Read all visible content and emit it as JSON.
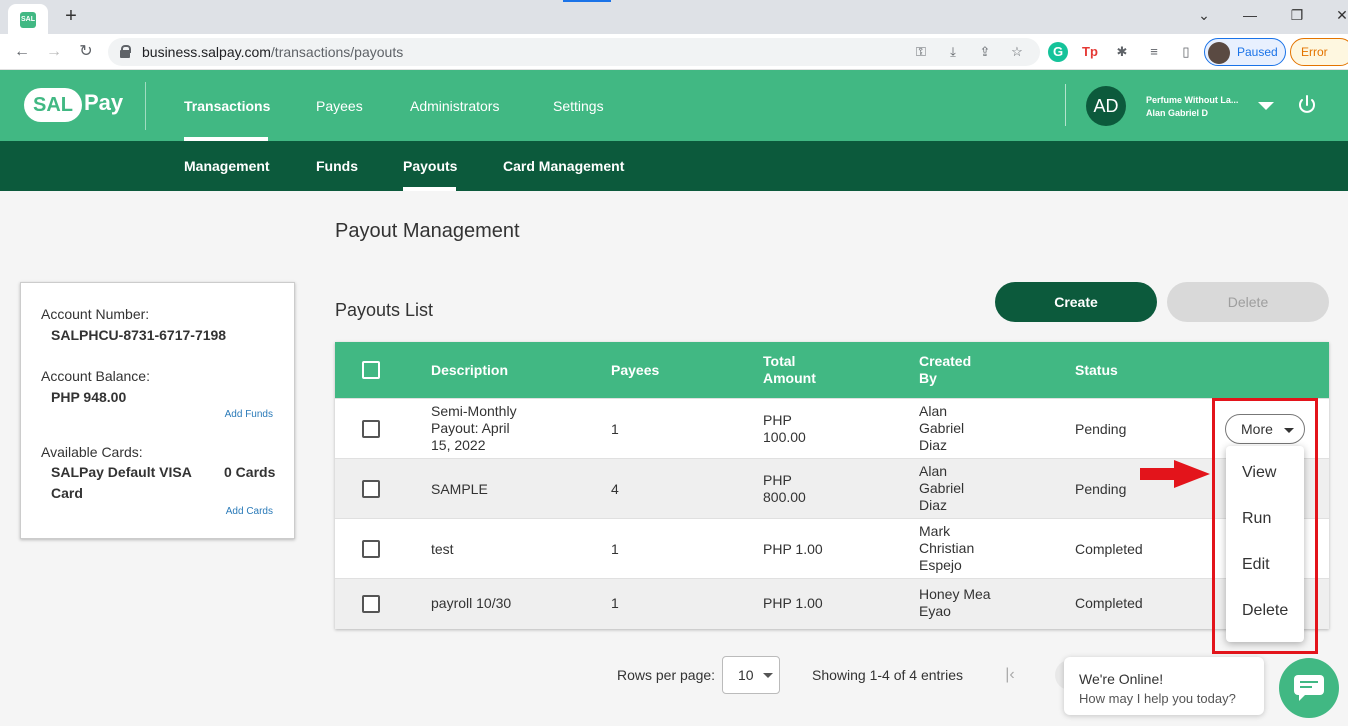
{
  "browser": {
    "url_domain": "business.salpay.com",
    "url_path": "/transactions/payouts",
    "profile_status": "Paused",
    "error_label": "Error"
  },
  "header": {
    "logo_sal": "SAL",
    "logo_pay": "Pay",
    "nav": [
      "Transactions",
      "Payees",
      "Administrators",
      "Settings"
    ],
    "active_nav": "Transactions",
    "avatar_initials": "AD",
    "business_name": "Perfume Without La...",
    "user_name": "Alan Gabriel D"
  },
  "subnav": {
    "items": [
      "Management",
      "Funds",
      "Payouts",
      "Card Management"
    ],
    "active": "Payouts"
  },
  "page": {
    "title": "Payout Management",
    "list_title": "Payouts List",
    "create_label": "Create",
    "delete_label": "Delete"
  },
  "account": {
    "number_label": "Account Number:",
    "number": "SALPHCU-8731-6717-7198",
    "balance_label": "Account Balance:",
    "balance": "PHP 948.00",
    "add_funds": "Add Funds",
    "cards_label": "Available Cards:",
    "card_name_line1": "SALPay Default VISA",
    "card_name_line2": "Card",
    "cards_count": "0 Cards",
    "add_cards": "Add Cards"
  },
  "table": {
    "headers": {
      "description": "Description",
      "payees": "Payees",
      "total_amount_1": "Total",
      "total_amount_2": "Amount",
      "created_by_1": "Created",
      "created_by_2": "By",
      "status": "Status"
    },
    "rows": [
      {
        "desc": [
          "Semi-Monthly",
          "Payout: April",
          "15, 2022"
        ],
        "payees": "1",
        "amount": [
          "PHP",
          "100.00"
        ],
        "created": [
          "Alan",
          "Gabriel",
          "Diaz"
        ],
        "status": "Pending"
      },
      {
        "desc": [
          "SAMPLE"
        ],
        "payees": "4",
        "amount": [
          "PHP",
          "800.00"
        ],
        "created": [
          "Alan",
          "Gabriel",
          "Diaz"
        ],
        "status": "Pending"
      },
      {
        "desc": [
          "test"
        ],
        "payees": "1",
        "amount": [
          "PHP 1.00"
        ],
        "created": [
          "Mark",
          "Christian",
          "Espejo"
        ],
        "status": "Completed"
      },
      {
        "desc": [
          "payroll 10/30"
        ],
        "payees": "1",
        "amount": [
          "PHP 1.00"
        ],
        "created": [
          "Honey Mea",
          "Eyao"
        ],
        "status": "Completed"
      }
    ],
    "more_label": "More"
  },
  "dropdown": {
    "items": [
      "View",
      "Run",
      "Edit",
      "Delete"
    ]
  },
  "pagination": {
    "rows_per_page_label": "Rows per page:",
    "rows_per_page": "10",
    "showing": "Showing 1-4 of 4 entries"
  },
  "chat": {
    "title": "We're Online!",
    "subtitle": "How may I help you today?"
  },
  "colors": {
    "brand_green": "#41b883",
    "dark_green": "#0c5a3c",
    "highlight_red": "#e3141b"
  }
}
